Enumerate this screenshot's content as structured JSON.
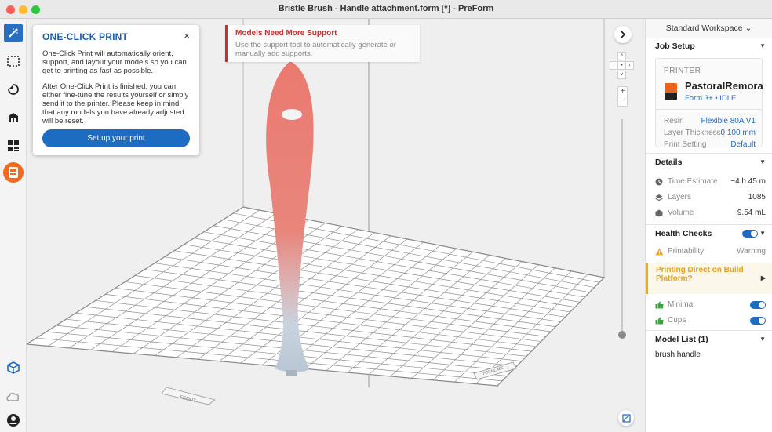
{
  "window": {
    "title": "Bristle Brush - Handle attachment.form [*] - PreForm"
  },
  "one_click": {
    "title": "ONE-CLICK PRINT",
    "close": "×",
    "para1": "One-Click Print will automatically orient, support, and layout your models so you can get to printing as fast as possible.",
    "para2": "After One-Click Print is finished, you can either fine-tune the results yourself or simply send it to the printer. Please keep in mind that any models you have already adjusted will be reset.",
    "button": "Set up your print"
  },
  "warning": {
    "title": "Models Need More Support",
    "text": "Use the support tool to automatically generate or manually add supports."
  },
  "viewport": {
    "front_label": "FRONT",
    "brand_label": "FORMLABS",
    "zoom_in": "+",
    "zoom_out": "−"
  },
  "panel": {
    "workspace": "Standard Workspace ⌄",
    "job_setup": "Job Setup",
    "printer_label": "PRINTER",
    "printer_name": "PastoralRemora",
    "printer_status": "Form 3+ • IDLE",
    "resin_label": "Resin",
    "resin_value": "Flexible 80A V1",
    "layer_label": "Layer Thickness",
    "layer_value": "0.100 mm",
    "setting_label": "Print Setting",
    "setting_value": "Default",
    "details": "Details",
    "time_label": "Time Estimate",
    "time_value": "~4 h 45 m",
    "layers_label": "Layers",
    "layers_value": "1085",
    "volume_label": "Volume",
    "volume_value": "9.54 mL",
    "health": "Health Checks",
    "printability_label": "Printability",
    "printability_value": "Warning",
    "alert": "Printing Direct on Build Platform?",
    "minima": "Minima",
    "cups": "Cups",
    "model_list": "Model List (1)",
    "model_item": "brush handle"
  },
  "colors": {
    "accent": "#1d6cc2",
    "warning_red": "#c9302c",
    "warning_amber": "#f0a820",
    "model_top": "#e8766e",
    "model_bottom": "#c9d3de"
  }
}
